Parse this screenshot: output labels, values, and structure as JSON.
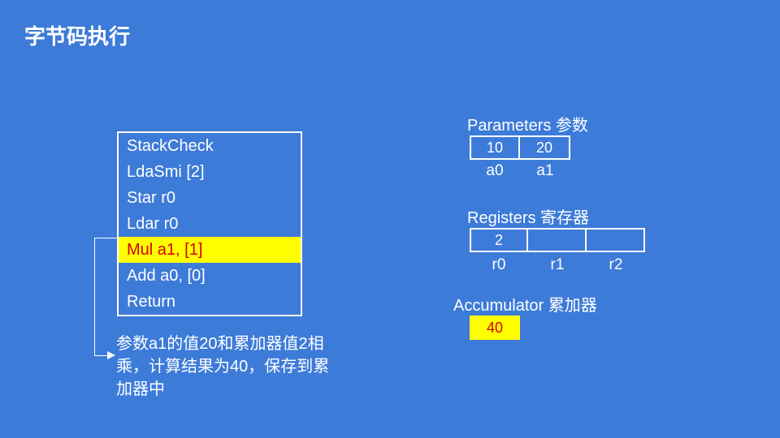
{
  "title": "字节码执行",
  "bytecode": {
    "lines": [
      "StackCheck",
      "LdaSmi [2]",
      "Star r0",
      "Ldar r0",
      "Mul a1, [1]",
      "Add a0, [0]",
      "Return"
    ],
    "active_index": 4
  },
  "caption": "参数a1的值20和累加器值2相乘，计算结果为40，保存到累加器中",
  "parameters": {
    "label": "Parameters 参数",
    "values": [
      "10",
      "20"
    ],
    "names": [
      "a0",
      "a1"
    ]
  },
  "registers": {
    "label": "Registers 寄存器",
    "values": [
      "2",
      "",
      ""
    ],
    "names": [
      "r0",
      "r1",
      "r2"
    ]
  },
  "accumulator": {
    "label": "Accumulator 累加器",
    "value": "40"
  },
  "chart_data": {
    "type": "table",
    "description": "Bytecode execution state diagram",
    "current_instruction": "Mul a1, [1]",
    "parameters": {
      "a0": 10,
      "a1": 20
    },
    "registers": {
      "r0": 2,
      "r1": null,
      "r2": null
    },
    "accumulator": 40,
    "explanation": "参数a1的值20和累加器值2相乘，计算结果为40，保存到累加器中"
  }
}
